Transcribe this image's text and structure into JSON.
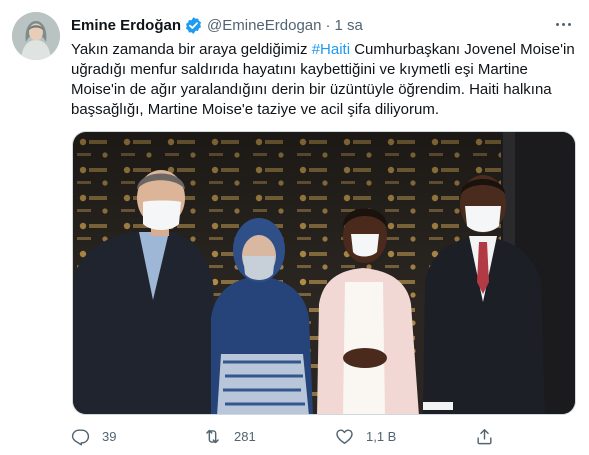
{
  "tweet": {
    "author_name": "Emine Erdoğan",
    "author_handle": "@EmineErdogan",
    "separator": "·",
    "time": "1 sa",
    "text_lines": {
      "l1_pre": "Yakın zamanda bir araya geldiğimiz ",
      "l1_tag": "#Haiti",
      "l1_post": " Cumhurbaşkanı Jovenel Moise'in",
      "l2": "uğradığı menfur saldırıda hayatını kaybettiğini ve kıymetli eşi Martine",
      "l3": "Moise'in de ağır yaralandığını derin bir üzüntüyle öğrendim. Haiti halkına",
      "l4": "başsağlığı, Martine Moise'e taziye ve acil şifa diliyorum."
    },
    "actions": {
      "reply_count": "39",
      "retweet_count": "281",
      "like_count": "1,1 B"
    }
  },
  "icons": {
    "verified": "verified-badge-icon",
    "more": "more-options-icon",
    "reply": "reply-icon",
    "retweet": "retweet-icon",
    "like": "like-heart-icon",
    "share": "share-icon"
  },
  "colors": {
    "link": "#1d9bf0",
    "secondary_text": "#536471",
    "primary_text": "#0f1419"
  }
}
